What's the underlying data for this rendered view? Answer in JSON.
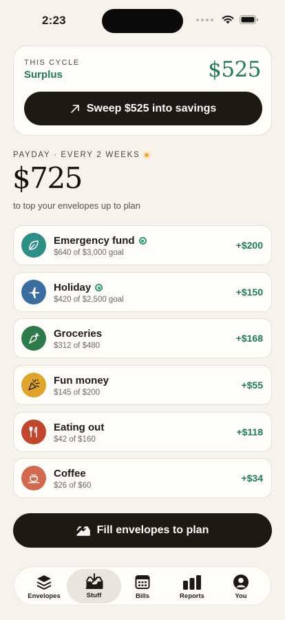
{
  "status_bar": {
    "time": "2:23"
  },
  "cycle": {
    "label": "THIS CYCLE",
    "status": "Surplus",
    "amount": "$525",
    "sweep_label": "Sweep $525 into savings"
  },
  "payday": {
    "label": "PAYDAY · EVERY 2 WEEKS",
    "amount": "$725",
    "subtitle": "to top your envelopes up to plan"
  },
  "envelopes": [
    {
      "name": "Emergency fund",
      "detail": "$640 of $3,000 goal",
      "amount": "+$200",
      "icon": "leaf-icon",
      "color": "#2e8f86"
    },
    {
      "name": "Holiday",
      "detail": "$420 of $2,500 goal",
      "amount": "+$150",
      "icon": "airplane-icon",
      "color": "#3b6ea0"
    },
    {
      "name": "Groceries",
      "detail": "$312 of $480",
      "amount": "+$168",
      "icon": "carrot-icon",
      "color": "#2e7a4a"
    },
    {
      "name": "Fun money",
      "detail": "$145 of $200",
      "amount": "+$55",
      "icon": "party-popper-icon",
      "color": "#e0a32c"
    },
    {
      "name": "Eating out",
      "detail": "$42 of $160",
      "amount": "+$118",
      "icon": "fork-knife-icon",
      "color": "#c0462e"
    },
    {
      "name": "Coffee",
      "detail": "$26 of $60",
      "amount": "+$34",
      "icon": "coffee-cup-icon",
      "color": "#d0694e"
    }
  ],
  "fill_button": {
    "label": "Fill envelopes to plan"
  },
  "tabs": [
    {
      "label": "Envelopes",
      "icon": "stack-icon"
    },
    {
      "label": "Stuff",
      "icon": "inbox-download-icon",
      "active": true
    },
    {
      "label": "Bills",
      "icon": "calendar-icon"
    },
    {
      "label": "Reports",
      "icon": "bar-chart-icon"
    },
    {
      "label": "You",
      "icon": "person-icon"
    }
  ]
}
